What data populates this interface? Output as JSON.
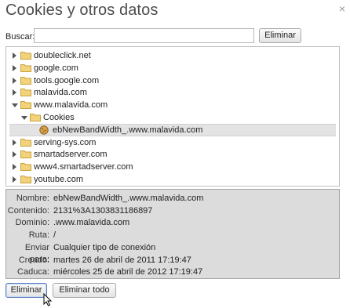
{
  "dialog": {
    "title": "Cookies y otros datos",
    "close_glyph": "×"
  },
  "search": {
    "label": "Buscar:",
    "value": "",
    "button_label": "Eliminar"
  },
  "tree": {
    "items": [
      {
        "label": "doubleclick.net",
        "expanded": false,
        "type": "folder",
        "depth": 0
      },
      {
        "label": "google.com",
        "expanded": false,
        "type": "folder",
        "depth": 0
      },
      {
        "label": "tools.google.com",
        "expanded": false,
        "type": "folder",
        "depth": 0
      },
      {
        "label": "malavida.com",
        "expanded": false,
        "type": "folder",
        "depth": 0
      },
      {
        "label": "www.malavida.com",
        "expanded": true,
        "type": "folder",
        "depth": 0
      },
      {
        "label": "Cookies",
        "expanded": true,
        "type": "folder",
        "depth": 1
      },
      {
        "label": "ebNewBandWidth_.www.malavida.com",
        "expanded": false,
        "type": "cookie",
        "depth": 2,
        "selected": true
      },
      {
        "label": "serving-sys.com",
        "expanded": false,
        "type": "folder",
        "depth": 0
      },
      {
        "label": "smartadserver.com",
        "expanded": false,
        "type": "folder",
        "depth": 0
      },
      {
        "label": "www4.smartadserver.com",
        "expanded": false,
        "type": "folder",
        "depth": 0
      },
      {
        "label": "youtube.com",
        "expanded": false,
        "type": "folder",
        "depth": 0
      }
    ]
  },
  "details": {
    "rows": [
      {
        "label": "Nombre:",
        "value": "ebNewBandWidth_.www.malavida.com"
      },
      {
        "label": "Contenido:",
        "value": "2131%3A1303831186897"
      },
      {
        "label": "Dominio:",
        "value": ".www.malavida.com"
      },
      {
        "label": "Ruta:",
        "value": "/"
      },
      {
        "label": "Enviar para:",
        "value": "Cualquier tipo de conexión"
      },
      {
        "label": "Creado:",
        "value": "martes 26 de abril de 2011 17:19:47"
      },
      {
        "label": "Caduca:",
        "value": "miércoles 25 de abril de 2012 17:19:47"
      }
    ]
  },
  "footer": {
    "delete_label": "Eliminar",
    "delete_all_label": "Eliminar todo"
  },
  "colors": {
    "folder_fill": "#f2d27a",
    "folder_stroke": "#c9a23c",
    "details_bg": "#dcdcdc",
    "selected_row": "#e3e3e3"
  }
}
